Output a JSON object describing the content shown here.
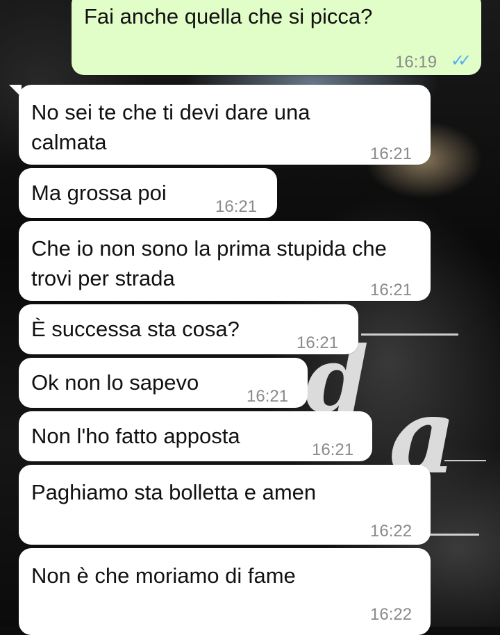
{
  "chat": {
    "messages": [
      {
        "direction": "outgoing",
        "text": "Fai anche quella che si picca?",
        "time": "16:19",
        "status_icon": "double-check-read-icon"
      },
      {
        "direction": "incoming",
        "text": "No sei te che ti devi dare una calmata",
        "time": "16:21"
      },
      {
        "direction": "incoming",
        "text": "Ma grossa poi",
        "time": "16:21"
      },
      {
        "direction": "incoming",
        "text": "Che io non sono la prima stupida che trovi per strada",
        "time": "16:21"
      },
      {
        "direction": "incoming",
        "text": "È successa sta cosa?",
        "time": "16:21"
      },
      {
        "direction": "incoming",
        "text": "Ok non lo sapevo",
        "time": "16:21"
      },
      {
        "direction": "incoming",
        "text": "Non l'ho fatto apposta",
        "time": "16:21"
      },
      {
        "direction": "incoming",
        "text": "Paghiamo sta bolletta e amen",
        "time": "16:22"
      },
      {
        "direction": "incoming",
        "text": "Non è che moriamo di fame",
        "time": "16:22"
      }
    ]
  },
  "colors": {
    "outgoing_bubble": "#e2fec8",
    "incoming_bubble": "#ffffff",
    "timestamp": "#8a8a8a",
    "read_ticks": "#4fb2f0"
  }
}
